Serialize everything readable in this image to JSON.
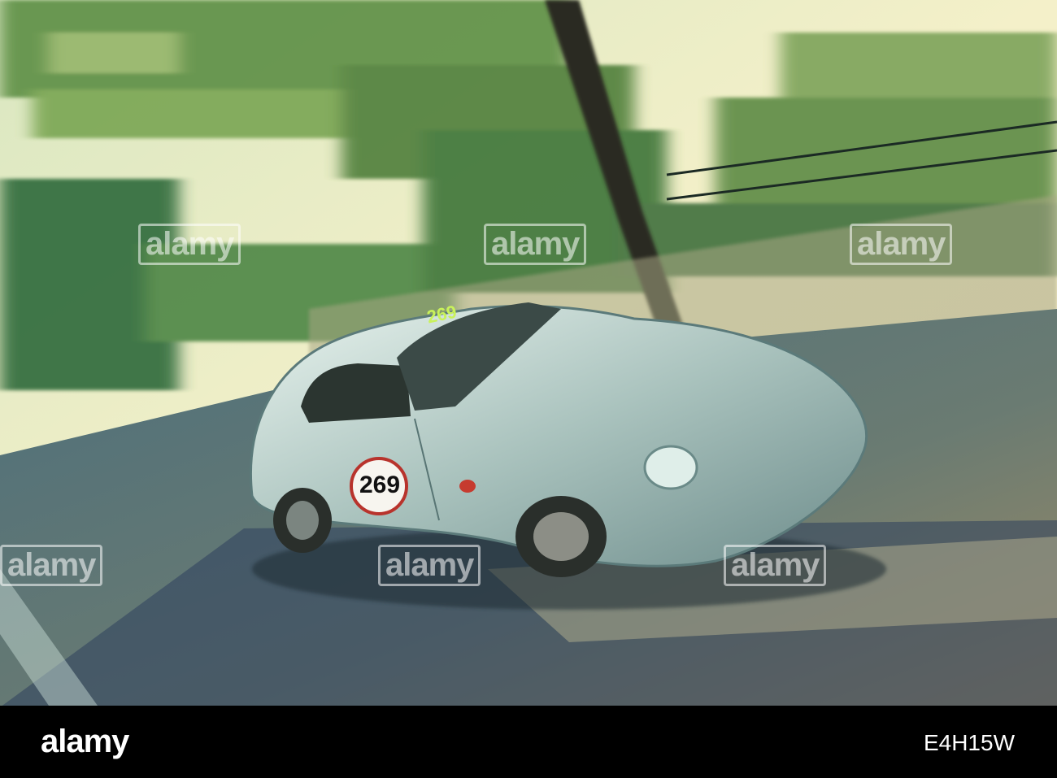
{
  "photo": {
    "subject": "car",
    "race_number": "269",
    "roof_number": "269"
  },
  "watermark": {
    "text": "alamy"
  },
  "footer": {
    "brand": "alamy",
    "image_id": "E4H15W"
  }
}
